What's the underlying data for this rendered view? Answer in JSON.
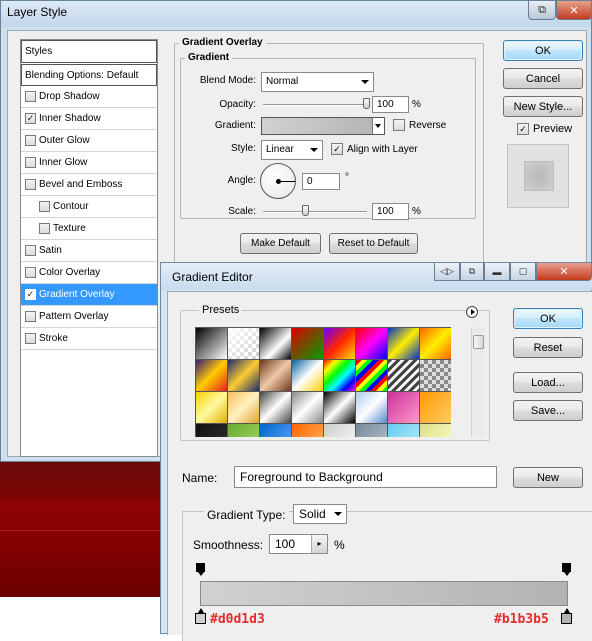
{
  "layer_style": {
    "title": "Layer Style",
    "styles_header": "Styles",
    "blending_options": "Blending Options: Default",
    "items": [
      {
        "label": "Drop Shadow",
        "checked": false,
        "indent": false,
        "selected": false
      },
      {
        "label": "Inner Shadow",
        "checked": true,
        "indent": false,
        "selected": false
      },
      {
        "label": "Outer Glow",
        "checked": false,
        "indent": false,
        "selected": false
      },
      {
        "label": "Inner Glow",
        "checked": false,
        "indent": false,
        "selected": false
      },
      {
        "label": "Bevel and Emboss",
        "checked": false,
        "indent": false,
        "selected": false
      },
      {
        "label": "Contour",
        "checked": false,
        "indent": true,
        "selected": false
      },
      {
        "label": "Texture",
        "checked": false,
        "indent": true,
        "selected": false
      },
      {
        "label": "Satin",
        "checked": false,
        "indent": false,
        "selected": false
      },
      {
        "label": "Color Overlay",
        "checked": false,
        "indent": false,
        "selected": false
      },
      {
        "label": "Gradient Overlay",
        "checked": true,
        "indent": false,
        "selected": true
      },
      {
        "label": "Pattern Overlay",
        "checked": false,
        "indent": false,
        "selected": false
      },
      {
        "label": "Stroke",
        "checked": false,
        "indent": false,
        "selected": false
      }
    ],
    "panel": {
      "group_title": "Gradient Overlay",
      "subgroup_title": "Gradient",
      "blend_mode_label": "Blend Mode:",
      "blend_mode_value": "Normal",
      "opacity_label": "Opacity:",
      "opacity_value": "100",
      "opacity_percent": 1.0,
      "percent_sign": "%",
      "gradient_label": "Gradient:",
      "reverse_label": "Reverse",
      "reverse_checked": false,
      "style_label": "Style:",
      "style_value": "Linear",
      "align_label": "Align with Layer",
      "align_checked": true,
      "angle_label": "Angle:",
      "angle_value": "0",
      "degree_sign": "°",
      "scale_label": "Scale:",
      "scale_value": "100",
      "scale_percent": 0.41,
      "make_default": "Make Default",
      "reset_default": "Reset to Default"
    },
    "buttons": {
      "ok": "OK",
      "cancel": "Cancel",
      "new_style": "New Style...",
      "preview_label": "Preview",
      "preview_checked": true
    }
  },
  "gradient_editor": {
    "title": "Gradient Editor",
    "presets_label": "Presets",
    "name_label": "Name:",
    "name_value": "Foreground to Background",
    "new_button": "New",
    "ok": "OK",
    "reset": "Reset",
    "load": "Load...",
    "save": "Save...",
    "gradient_type_label": "Gradient Type:",
    "gradient_type_value": "Solid",
    "smoothness_label": "Smoothness:",
    "smoothness_value": "100",
    "percent_sign": "%",
    "stops": {
      "left_color": "#d0d1d3",
      "right_color": "#b1b3b5"
    },
    "left_color_label": "#d0d1d3",
    "right_color_label": "#b1b3b5",
    "presets": [
      "linear-gradient(135deg,#000,#fff)",
      "linear-gradient(135deg,#fff 0%,rgba(255,255,255,0) 100%),repeating-conic-gradient(#ccc 0% 25%,#fff 0% 50%) 0 0/8px 8px",
      "linear-gradient(135deg,#000 0%,#fff 60%,#000 100%)",
      "linear-gradient(135deg,#e00000,#00a000)",
      "linear-gradient(135deg,#6a00ff,#ff2200,#ffdd00)",
      "linear-gradient(135deg,#ff0000,#ff00ff,#0000ff)",
      "linear-gradient(135deg,#0033cc,#ffee00,#0033cc)",
      "linear-gradient(135deg,#ff6600,#ffee00,#ff6600)",
      "linear-gradient(135deg,#3a1a7a,#ffcc00,#e02020)",
      "linear-gradient(135deg,#1a2a6a,#ffcc33,#1a2a6a)",
      "linear-gradient(135deg,#6b3a1a,#f0c8a8,#6b3a1a)",
      "linear-gradient(135deg,#0060a0,#ffffff,#ffcc00)",
      "linear-gradient(135deg,#ff0000,#ffff00,#00ff00,#00ffff,#0000ff,#ff00ff)",
      "repeating-linear-gradient(135deg,#ff0000 0 4px,#ffff00 4px 8px,#00ff00 8px 12px,#0000ff 12px 16px)",
      "repeating-linear-gradient(135deg,#444 0 3px,#fff 3px 6px)",
      "repeating-conic-gradient(#888 0% 25%,#ddd 0% 50%) 0 0/8px 8px",
      "linear-gradient(135deg,#f5d000,#fff9a0,#e0b000)",
      "linear-gradient(135deg,#f8c060,#fff0c0,#e0a030)",
      "linear-gradient(135deg,#444,#ffffff,#444)",
      "linear-gradient(135deg,#888,#fff,#888)",
      "linear-gradient(135deg,#000,#ffffff,#000)",
      "linear-gradient(135deg,#aaccee,#ffffff,#5588cc)",
      "linear-gradient(135deg,#cc3399,#ff99cc)",
      "linear-gradient(135deg,#ff9900,#ffcc66)",
      "linear-gradient(135deg,#111,#333)",
      "linear-gradient(135deg,#66aa33,#aadd66)",
      "linear-gradient(135deg,#0066cc,#66aaff)",
      "linear-gradient(135deg,#ff6600,#ffbb66)",
      "linear-gradient(135deg,#cccccc,#ffffff)",
      "linear-gradient(135deg,#778899,#bbc8d4)",
      "linear-gradient(135deg,#66ccee,#bbeeff)",
      "linear-gradient(135deg,#dddd88,#ffffcc)"
    ]
  },
  "background": {
    "canvas_color": "#7b0000"
  }
}
